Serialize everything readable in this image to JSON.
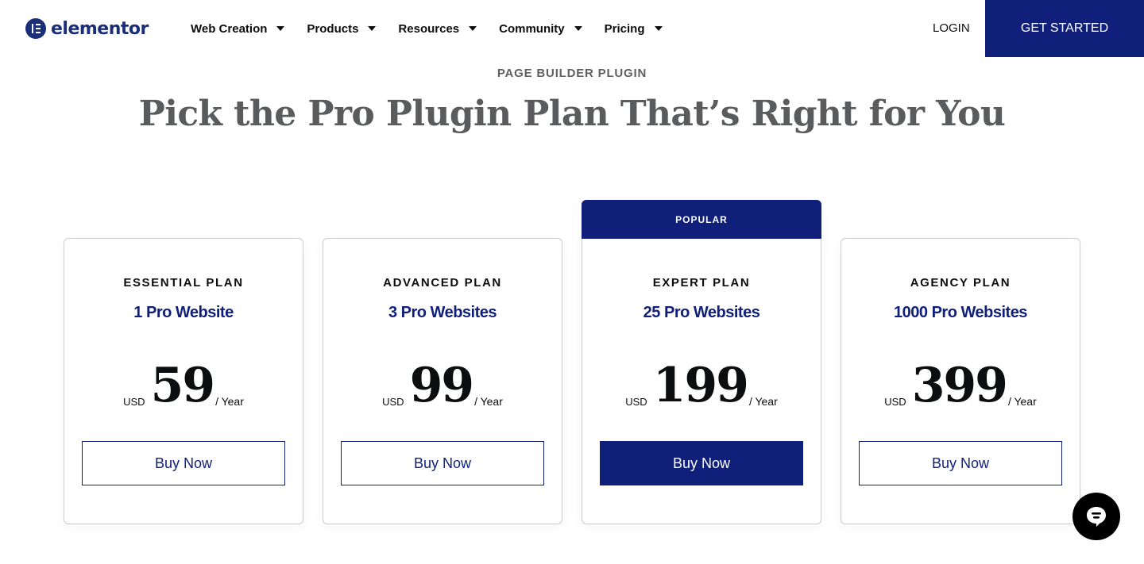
{
  "brand": {
    "name": "elementor",
    "color": "#1a2e7a",
    "accent": "#0f1f7a"
  },
  "nav": {
    "items": [
      {
        "label": "Web Creation"
      },
      {
        "label": "Products"
      },
      {
        "label": "Resources"
      },
      {
        "label": "Community"
      },
      {
        "label": "Pricing"
      }
    ],
    "login": "LOGIN",
    "cta": "GET STARTED"
  },
  "hero": {
    "eyebrow": "PAGE BUILDER PLUGIN",
    "title": "Pick the Pro Plugin Plan That’s Right for You"
  },
  "plans": [
    {
      "name": "ESSENTIAL PLAN",
      "sites": "1 Pro Website",
      "currency": "USD",
      "price": "59",
      "period": "/ Year",
      "button": "Buy Now",
      "popular": false
    },
    {
      "name": "ADVANCED PLAN",
      "sites": "3 Pro Websites",
      "currency": "USD",
      "price": "99",
      "period": "/ Year",
      "button": "Buy Now",
      "popular": false
    },
    {
      "name": "EXPERT PLAN",
      "sites": "25 Pro Websites",
      "currency": "USD",
      "price": "199",
      "period": "/ Year",
      "button": "Buy Now",
      "popular": true,
      "badge": "POPULAR"
    },
    {
      "name": "AGENCY PLAN",
      "sites": "1000 Pro Websites",
      "currency": "USD",
      "price": "399",
      "period": "/ Year",
      "button": "Buy Now",
      "popular": false
    }
  ],
  "icons": {
    "chat": "chat-bubble-icon",
    "caret": "caret-down-icon",
    "logo": "elementor-logo-icon"
  }
}
